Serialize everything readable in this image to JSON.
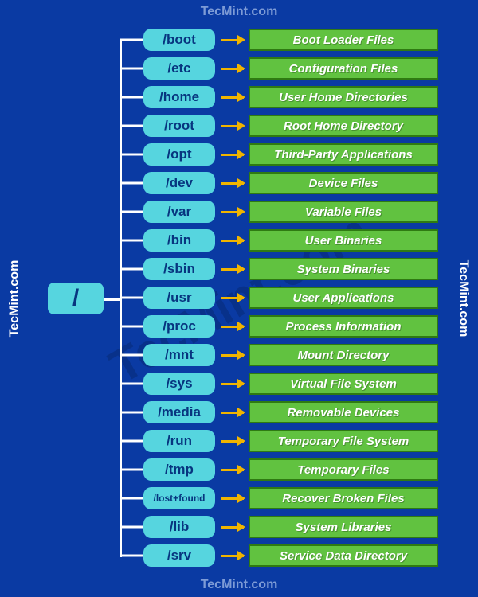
{
  "watermark": "TecMint.com",
  "root": {
    "label": "/"
  },
  "items": [
    {
      "dir": "/boot",
      "desc": "Boot Loader Files"
    },
    {
      "dir": "/etc",
      "desc": "Configuration Files"
    },
    {
      "dir": "/home",
      "desc": "User Home Directories"
    },
    {
      "dir": "/root",
      "desc": "Root Home Directory"
    },
    {
      "dir": "/opt",
      "desc": "Third-Party Applications"
    },
    {
      "dir": "/dev",
      "desc": "Device Files"
    },
    {
      "dir": "/var",
      "desc": "Variable Files"
    },
    {
      "dir": "/bin",
      "desc": "User Binaries"
    },
    {
      "dir": "/sbin",
      "desc": "System Binaries"
    },
    {
      "dir": "/usr",
      "desc": "User Applications"
    },
    {
      "dir": "/proc",
      "desc": "Process Information"
    },
    {
      "dir": "/mnt",
      "desc": "Mount Directory"
    },
    {
      "dir": "/sys",
      "desc": "Virtual File System"
    },
    {
      "dir": "/media",
      "desc": "Removable Devices"
    },
    {
      "dir": "/run",
      "desc": "Temporary File System"
    },
    {
      "dir": "/tmp",
      "desc": "Temporary Files"
    },
    {
      "dir": "/lost+found",
      "desc": "Recover Broken Files",
      "small": true
    },
    {
      "dir": "/lib",
      "desc": "System Libraries"
    },
    {
      "dir": "/srv",
      "desc": "Service Data Directory"
    }
  ]
}
